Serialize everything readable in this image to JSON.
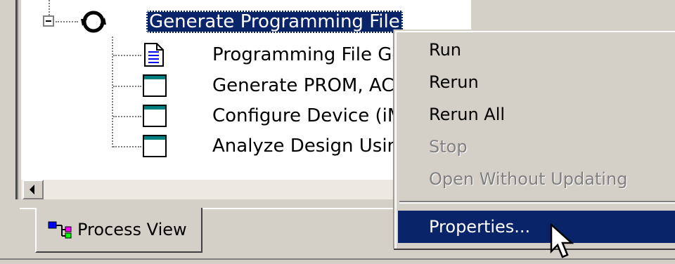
{
  "tree": {
    "parent": {
      "label": "Generate Programming File",
      "icon": "refresh-icon"
    },
    "children": [
      {
        "label": "Programming File Generation Report",
        "icon": "report-document-icon"
      },
      {
        "label": "Generate PROM, ACE, or JTAG File",
        "icon": "process-window-icon"
      },
      {
        "label": "Configure Device (iMPACT)",
        "icon": "process-window-icon"
      },
      {
        "label": "Analyze Design Using ChipScope",
        "icon": "process-window-icon"
      }
    ]
  },
  "tabs": [
    {
      "label": "Process View",
      "icon": "process-view-icon"
    }
  ],
  "context_menu": {
    "items": [
      {
        "label": "Run",
        "enabled": true,
        "highlighted": false
      },
      {
        "label": "Rerun",
        "enabled": true,
        "highlighted": false
      },
      {
        "label": "Rerun All",
        "enabled": true,
        "highlighted": false
      },
      {
        "label": "Stop",
        "enabled": false,
        "highlighted": false
      },
      {
        "label": "Open Without Updating",
        "enabled": false,
        "highlighted": false
      },
      {
        "label": "Properties...",
        "enabled": true,
        "highlighted": true
      }
    ]
  },
  "colors": {
    "selection": "#0a246a",
    "face": "#d4d0c8",
    "disabled_text": "#808080"
  }
}
